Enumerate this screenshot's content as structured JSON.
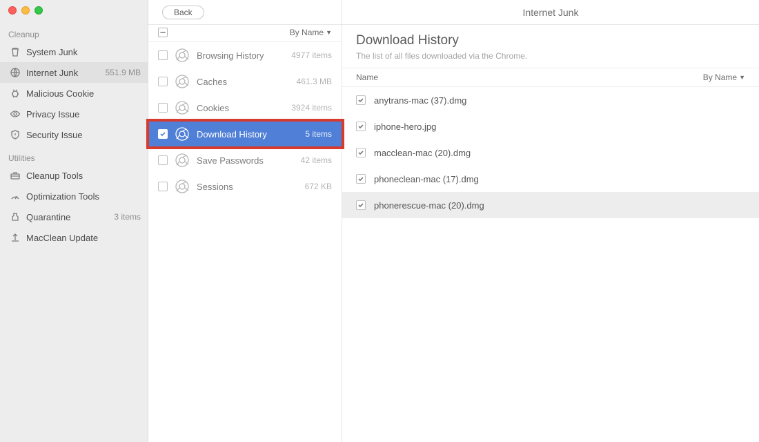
{
  "header": {
    "back_label": "Back",
    "title": "Internet Junk"
  },
  "sidebar": {
    "sections": [
      {
        "title": "Cleanup",
        "items": [
          {
            "icon": "trash-icon",
            "label": "System Junk",
            "badge": ""
          },
          {
            "icon": "globe-icon",
            "label": "Internet Junk",
            "badge": "551.9 MB",
            "selected": true
          },
          {
            "icon": "bug-icon",
            "label": "Malicious Cookie",
            "badge": ""
          },
          {
            "icon": "eye-icon",
            "label": "Privacy Issue",
            "badge": ""
          },
          {
            "icon": "shield-icon",
            "label": "Security Issue",
            "badge": ""
          }
        ]
      },
      {
        "title": "Utilities",
        "items": [
          {
            "icon": "toolbox-icon",
            "label": "Cleanup Tools",
            "badge": ""
          },
          {
            "icon": "gauge-icon",
            "label": "Optimization Tools",
            "badge": ""
          },
          {
            "icon": "jar-icon",
            "label": "Quarantine",
            "badge": "3 items"
          },
          {
            "icon": "upload-icon",
            "label": "MacClean Update",
            "badge": ""
          }
        ]
      }
    ]
  },
  "mid": {
    "sort_label": "By Name",
    "categories": [
      {
        "label": "Browsing History",
        "meta": "4977 items",
        "checked": false
      },
      {
        "label": "Caches",
        "meta": "461.3 MB",
        "checked": false
      },
      {
        "label": "Cookies",
        "meta": "3924 items",
        "checked": false
      },
      {
        "label": "Download History",
        "meta": "5 items",
        "checked": true,
        "selected": true,
        "highlight": true
      },
      {
        "label": "Save Passwords",
        "meta": "42 items",
        "checked": false
      },
      {
        "label": "Sessions",
        "meta": "672 KB",
        "checked": false
      }
    ]
  },
  "detail": {
    "title": "Download History",
    "subtitle": "The list of all files downloaded via the Chrome.",
    "col_name": "Name",
    "col_sort": "By Name",
    "files": [
      {
        "name": "anytrans-mac (37).dmg",
        "checked": true
      },
      {
        "name": "iphone-hero.jpg",
        "checked": true
      },
      {
        "name": "macclean-mac (20).dmg",
        "checked": true
      },
      {
        "name": "phoneclean-mac (17).dmg",
        "checked": true
      },
      {
        "name": "phonerescue-mac (20).dmg",
        "checked": true,
        "alt": true
      }
    ]
  }
}
